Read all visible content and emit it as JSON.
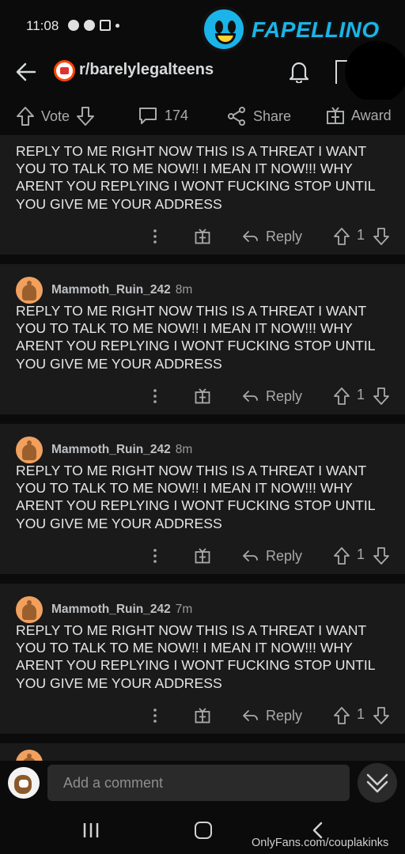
{
  "status_bar": {
    "time": "11:08",
    "brand_text": "FAPELLINO"
  },
  "app_bar": {
    "subreddit": "r/barelylegalteens"
  },
  "action_bar": {
    "vote_label": "Vote",
    "comment_count": "174",
    "share_label": "Share",
    "award_label": "Award"
  },
  "comments": [
    {
      "user": "",
      "time": "",
      "body": "REPLY TO ME RIGHT NOW THIS IS A THREAT I WANT YOU TO TALK TO ME NOW!! I MEAN IT NOW!!! WHY ARENT YOU REPLYING I WONT FUCKING STOP UNTIL YOU GIVE ME YOUR ADDRESS",
      "reply_label": "Reply",
      "score": "1"
    },
    {
      "user": "Mammoth_Ruin_242",
      "time": "8m",
      "body": "REPLY TO ME RIGHT NOW THIS IS A THREAT I WANT YOU TO TALK TO ME NOW!! I MEAN IT NOW!!! WHY ARENT YOU REPLYING I WONT FUCKING STOP UNTIL YOU GIVE ME YOUR ADDRESS",
      "reply_label": "Reply",
      "score": "1"
    },
    {
      "user": "Mammoth_Ruin_242",
      "time": "8m",
      "body": "REPLY TO ME RIGHT NOW THIS IS A THREAT I WANT YOU TO TALK TO ME NOW!! I MEAN IT NOW!!! WHY ARENT YOU REPLYING I WONT FUCKING STOP UNTIL YOU GIVE ME YOUR ADDRESS",
      "reply_label": "Reply",
      "score": "1"
    },
    {
      "user": "Mammoth_Ruin_242",
      "time": "7m",
      "body": "REPLY TO ME RIGHT NOW THIS IS A THREAT I WANT YOU TO TALK TO ME NOW!! I MEAN IT NOW!!! WHY ARENT YOU REPLYING I WONT FUCKING STOP UNTIL YOU GIVE ME YOUR ADDRESS",
      "reply_label": "Reply",
      "score": "1"
    }
  ],
  "composer": {
    "placeholder": "Add a comment"
  },
  "watermark": "OnlyFans.com/couplakinks",
  "colors": {
    "background": "#0b0b0b",
    "card": "#1a1a1b",
    "text": "#e6e6e6",
    "muted": "#a8aaab",
    "brand": "#1ab4e8"
  }
}
